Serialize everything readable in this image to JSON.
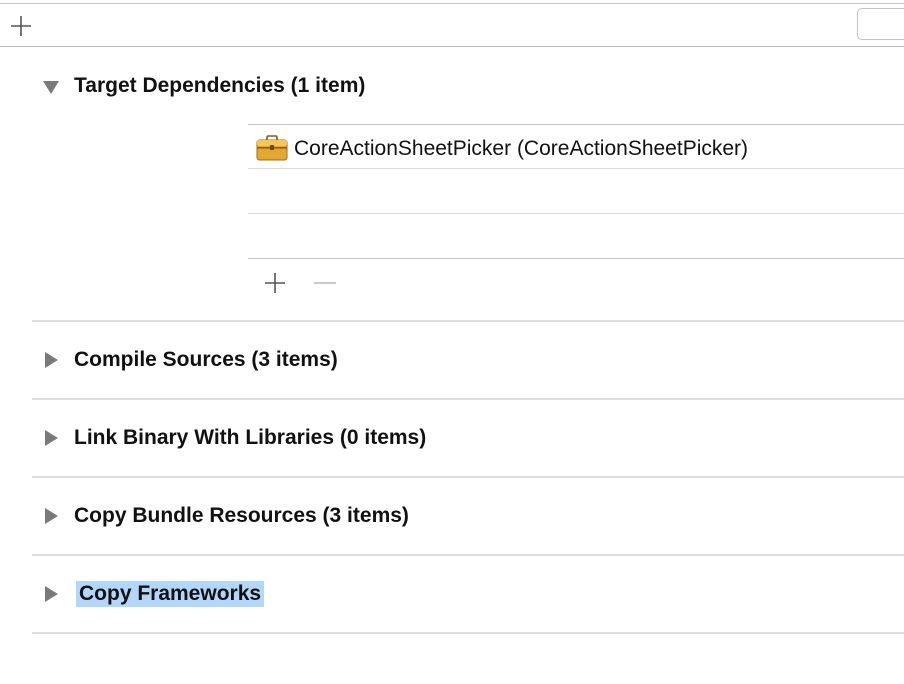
{
  "toolbar": {
    "add_icon": "plus-icon",
    "filter_placeholder": ""
  },
  "phases": [
    {
      "title": "Target Dependencies (1 item)",
      "expanded": true
    },
    {
      "title": "Compile Sources (3 items)",
      "expanded": false
    },
    {
      "title": "Link Binary With Libraries (0 items)",
      "expanded": false
    },
    {
      "title": "Copy Bundle Resources (3 items)",
      "expanded": false
    },
    {
      "title": "Copy Frameworks",
      "expanded": false,
      "selected": true
    }
  ],
  "dependencies": [
    {
      "label": "CoreActionSheetPicker (CoreActionSheetPicker)",
      "icon": "toolbox-icon"
    }
  ],
  "dependency_controls": {
    "add_icon": "plus-icon",
    "remove_icon": "minus-icon"
  },
  "colors": {
    "selection": "#b3d6fb",
    "toolbox": "#e3a72f",
    "disclosure": "#7a7a7a"
  }
}
